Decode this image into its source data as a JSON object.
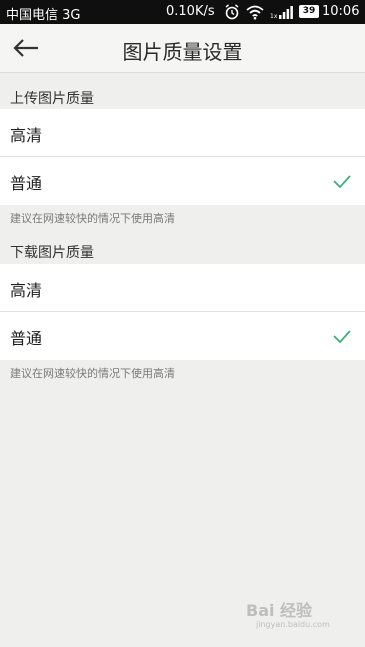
{
  "status_bar": {
    "carrier": "中国电信 3G",
    "speed": "0.10K/s",
    "battery": "39",
    "time": "10:06",
    "icons": [
      "alarm-icon",
      "wifi-icon",
      "signal-icon"
    ]
  },
  "header": {
    "title": "图片质量设置",
    "back_icon": "arrow-left-icon"
  },
  "upload": {
    "label": "上传图片质量",
    "options": [
      {
        "label": "高清",
        "selected": false
      },
      {
        "label": "普通",
        "selected": true
      }
    ],
    "hint": "建议在网速较快的情况下使用高清"
  },
  "download": {
    "label": "下载图片质量",
    "options": [
      {
        "label": "高清",
        "selected": false
      },
      {
        "label": "普通",
        "selected": true
      }
    ],
    "hint": "建议在网速较快的情况下使用高清"
  },
  "watermark": {
    "text": "Bai 经验",
    "url": "jingyan.baidu.com"
  },
  "colors": {
    "check": "#3fb07a",
    "background": "#efefed",
    "status_bar": "#0f0f0f"
  }
}
